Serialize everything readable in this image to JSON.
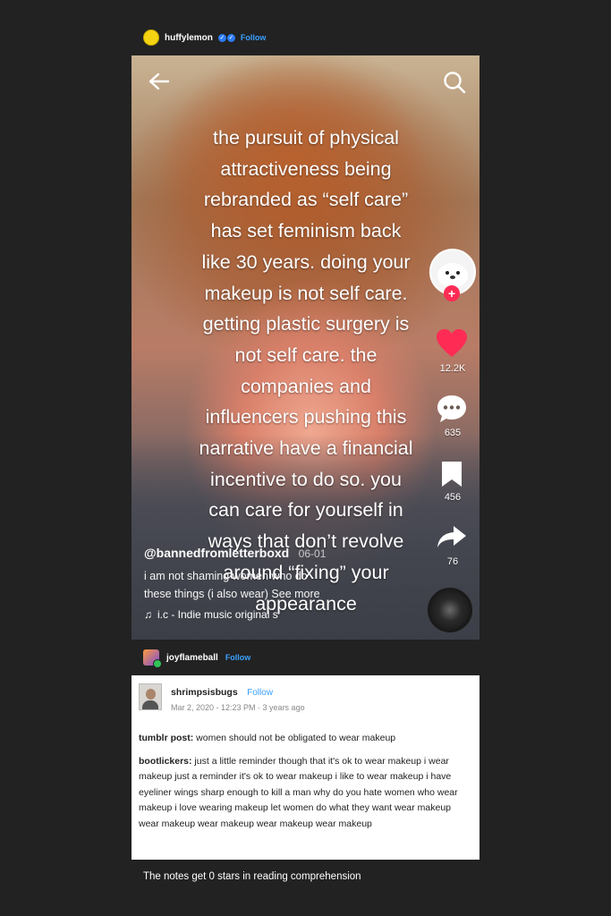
{
  "post": {
    "username": "huffylemon",
    "follow_label": "Follow"
  },
  "video": {
    "overlay_text": "the pursuit of physical\nattractiveness being\nrebranded as “self care”\nhas set feminism back\nlike 30 years. doing your\nmakeup is not self care.\ngetting plastic surgery is\nnot self care. the\ncompanies and\ninfluencers pushing this\nnarrative have a financial\nincentive to do so. you\ncan care for yourself in\nways that don’t revolve\naround “fixing” your\nappearance",
    "likes": "12.2K",
    "comments": "635",
    "saves": "456",
    "shares": "76",
    "caption_user": "@bannedfromletterboxd",
    "caption_date": "06-01",
    "caption_desc": "i am not shaming women who do\nthese things (i also wear) See more",
    "music": "i.c - Indie music  original s"
  },
  "reblog": {
    "username": "joyflameball",
    "follow_label": "Follow"
  },
  "card": {
    "username": "shrimpsisbugs",
    "follow_label": "Follow",
    "meta": "Mar 2, 2020 - 12:23 PM  ·  3 years ago",
    "line1_label": "tumblr post:",
    "line1_text": " women should not be obligated to wear makeup",
    "line2_label": "bootlickers:",
    "line2_text": " just a little reminder though that it's ok to wear makeup i wear makeup just a reminder it's ok to wear makeup i like to wear makeup i have eyeliner wings sharp enough to kill a man why do you hate women who wear makeup i love wearing makeup let women do what they want wear makeup wear makeup wear makeup wear makeup wear makeup"
  },
  "footer": {
    "text": "The notes get 0 stars in reading comprehension"
  },
  "colors": {
    "background": "#222222",
    "tiktok_red": "#fe2c55",
    "link_blue": "#3aa0ff"
  }
}
